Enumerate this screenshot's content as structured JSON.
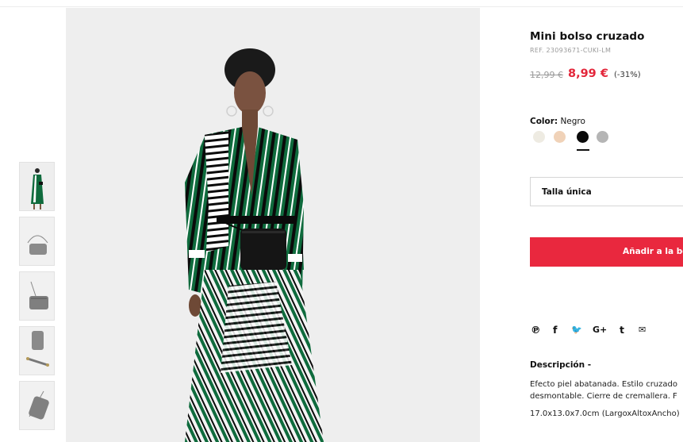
{
  "product": {
    "title": "Mini bolso cruzado",
    "ref": "REF. 23093671-CUKI-LM",
    "old_price": "12,99 €",
    "new_price": "8,99 €",
    "discount": "(-31%)"
  },
  "color": {
    "label": "Color:",
    "selected": "Negro",
    "swatches": [
      {
        "name": "crudo",
        "hex": "#eeebe2"
      },
      {
        "name": "rosa",
        "hex": "#f0d2b8"
      },
      {
        "name": "negro",
        "hex": "#0a0a0a"
      },
      {
        "name": "gris",
        "hex": "#b5b5b5"
      }
    ]
  },
  "size": {
    "selected": "Talla única"
  },
  "add_to_bag": {
    "label": "Añadir a la bolsa"
  },
  "social": {
    "icons": [
      "pinterest-icon",
      "facebook-icon",
      "twitter-icon",
      "google-plus-icon",
      "tumblr-icon",
      "email-icon"
    ],
    "glyphs": [
      "℗",
      "f",
      "🐦",
      "G+",
      "t",
      "✉"
    ]
  },
  "description": {
    "heading": "Descripción -",
    "text": "Efecto piel abatanada. Estilo cruzado\ndesmontable. Cierre de cremallera. F",
    "dimensions": "17.0x13.0x7.0cm (LargoxAltoxAncho)"
  },
  "thumbnails": [
    {
      "alt": "model-full-view"
    },
    {
      "alt": "bag-front"
    },
    {
      "alt": "bag-side"
    },
    {
      "alt": "bag-strap"
    },
    {
      "alt": "bag-angle"
    }
  ],
  "colors": {
    "accent": "#e9283e",
    "price": "#e3263a",
    "dress_green": "#0f6b3d"
  }
}
